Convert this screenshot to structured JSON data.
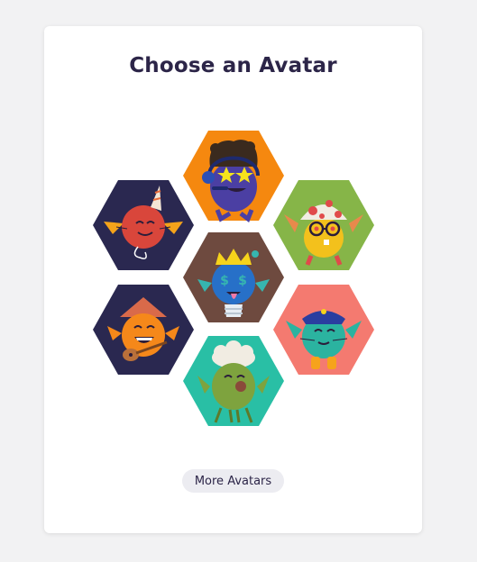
{
  "dialog": {
    "title": "Choose an Avatar",
    "more_label": "More Avatars"
  },
  "colors": {
    "page_bg": "#f2f2f3",
    "card_bg": "#ffffff",
    "title_text": "#2c2548",
    "button_bg": "#ececf1"
  },
  "avatars": [
    {
      "name": "headphones-star-eyes-monster",
      "bg": "#f5880f"
    },
    {
      "name": "party-horn-red-monster",
      "bg": "#2a2850"
    },
    {
      "name": "mushroom-cap-glasses-monster",
      "bg": "#86b548"
    },
    {
      "name": "crowned-blue-money-eyes-monster",
      "bg": "#6e4a3f"
    },
    {
      "name": "hat-guitar-orange-monster",
      "bg": "#2a2850"
    },
    {
      "name": "police-cap-teal-cat-monster",
      "bg": "#f47a70"
    },
    {
      "name": "chef-hat-green-monster",
      "bg": "#29bfa5"
    }
  ]
}
